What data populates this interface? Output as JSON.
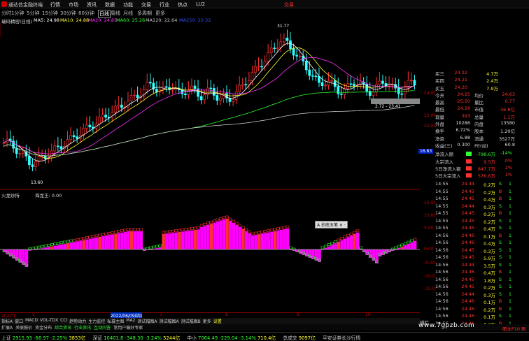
{
  "titlebar": {
    "app": "通达信金融终端",
    "menu": [
      "行情",
      "市场",
      "资讯",
      "数据",
      "功能",
      "交易",
      "行业",
      "热点",
      "LU2"
    ],
    "right": "交易"
  },
  "toolbar": {
    "items": [
      "分时",
      "1分钟",
      "5分钟",
      "15分钟",
      "30分钟",
      "60分钟",
      "日线",
      "周线",
      "月线",
      "多周期",
      "更多"
    ],
    "active": "日线"
  },
  "chart_title": "瑞玛精密(日线)",
  "ma_legend": [
    {
      "label": "MA5: 24.98",
      "color": "#ffffff"
    },
    {
      "label": "MA10: 24.88",
      "color": "#ffff30"
    },
    {
      "label": "MA20: 24.85",
      "color": "#ff30ff"
    },
    {
      "label": "MA60: 25.26",
      "color": "#30ff30"
    },
    {
      "label": "MA120: 22.64",
      "color": "#c8c8c8"
    },
    {
      "label": "MA250: 20.32",
      "color": "#3050ff"
    }
  ],
  "price_axis": [
    "24.00",
    "22.00",
    "20.00"
  ],
  "annotations": {
    "high": "31.77",
    "low": "13.60",
    "range_label": "2.72 - 23.41"
  },
  "indicator": {
    "title": "火龙炒持",
    "name": "海龙王: 0.00",
    "axis": [
      "15.00",
      "10.00",
      "5.00",
      "0.00",
      "-5.00",
      "-10.00",
      "-15.00"
    ],
    "popup": "A 抄底五笔 ✕ ·"
  },
  "date_axis": [
    "2022年",
    "5",
    "2022/06/09(四)",
    "7",
    "8",
    "9",
    "10"
  ],
  "indicator_tabs": [
    "指标A",
    "窗口",
    "MACD",
    "VOL-TDX",
    "CCI",
    "趋势动力",
    "主力监控",
    "私募主图",
    "MA2",
    "测试幅图A",
    "测试幅图A",
    "测试幅图B",
    "更多",
    "设置"
  ],
  "info_tabs": [
    "扩展A",
    "关联报价",
    "资金分布",
    "综合资讯",
    "行业资讯",
    "互动问答",
    "常用户偏好专家"
  ],
  "side": {
    "orderbook": [
      {
        "label": "买三",
        "price": "24.22",
        "vol": "4.7万"
      },
      {
        "label": "买四",
        "price": "24.21",
        "vol": "2.4万"
      },
      {
        "label": "买五",
        "price": "24.20",
        "vol": "7.9万"
      }
    ],
    "stats": [
      {
        "l1": "今开",
        "v1": "24.25",
        "l2": "均价",
        "v2": "24.63"
      },
      {
        "l1": "最高",
        "v1": "25.50",
        "l2": "量比",
        "v2": "0.77"
      },
      {
        "l1": "最低",
        "v1": "24.28",
        "l2": "市值",
        "v2": "36.8亿"
      },
      {
        "l1": "现量",
        "v1": "393",
        "l2": "总量",
        "v2": "1.1万"
      },
      {
        "l1": "外盘",
        "v1": "10286",
        "l2": "内盘",
        "v2": "13580"
      },
      {
        "l1": "换手",
        "v1": "6.72%",
        "l2": "股本",
        "v2": "1.20亿"
      },
      {
        "l1": "净资",
        "v1": "6.88",
        "l2": "流通",
        "v2": "3527万"
      },
      {
        "l1": "收益(三)",
        "v1": "0.300",
        "l2": "PE(动)",
        "v2": "60.8"
      }
    ],
    "flows": [
      {
        "label": "净流入额",
        "val": "-798.6万",
        "pct": "-14%",
        "color": "#30ff30"
      },
      {
        "label": "大宗流入",
        "val": "9.5万",
        "pct": "0%",
        "color": "#ff3030"
      },
      {
        "label": "5日净流入额",
        "val": "847.7万",
        "pct": "2%",
        "color": "#ff3030"
      },
      {
        "label": "5日大宗流入",
        "val": "578.6万",
        "pct": "1%",
        "color": "#ff3030"
      }
    ],
    "ticks": [
      [
        "14:55",
        "24.44",
        "0.2万",
        "S"
      ],
      [
        "14:55",
        "24.45",
        "0.2万",
        "B"
      ],
      [
        "14:55",
        "24.45",
        "0.4万",
        "B"
      ],
      [
        "14:55",
        "24.44",
        "0.3万",
        "S"
      ],
      [
        "14:55",
        "24.45",
        "0.2万",
        "B"
      ],
      [
        "14:55",
        "24.45",
        "0.2万",
        "S"
      ],
      [
        "14:55",
        "24.45",
        "0.4万",
        "S"
      ],
      [
        "14:56",
        "24.46",
        "0.1万",
        "B"
      ],
      [
        "14:56",
        "24.46",
        "0.4万",
        "S"
      ],
      [
        "14:56",
        "24.45",
        "0.3万",
        "S"
      ],
      [
        "14:56",
        "24.45",
        "5.9万",
        "S"
      ],
      [
        "14:56",
        "24.44",
        "3.5万",
        "S"
      ],
      [
        "14:56",
        "24.46",
        "0.4万",
        "B"
      ],
      [
        "14:56",
        "24.45",
        "1.8万",
        "S"
      ],
      [
        "14:56",
        "24.45",
        "0.2万",
        "S"
      ],
      [
        "14:56",
        "24.44",
        "0.3万",
        "S"
      ],
      [
        "14:56",
        "24.46",
        "0.1万",
        "B"
      ],
      [
        "14:56",
        "24.46",
        "0.2万",
        "B"
      ],
      [
        "14:56",
        "24.46",
        "0.1万",
        "S"
      ],
      [
        "14:56",
        "24.46",
        "0.2万",
        "B"
      ]
    ],
    "label_1683": "16.83"
  },
  "bottom": {
    "tail_label": "横栏",
    "status_right": "图文F10 刷",
    "indices": [
      {
        "name": "上证",
        "value": "2915.93",
        "chg": "-66.97",
        "pct": "-2.25%",
        "amt": "3853亿"
      },
      {
        "name": "深证",
        "value": "10401.8",
        "chg": "-348.30",
        "pct": "-3.24%",
        "amt": "5244亿"
      },
      {
        "name": "中小",
        "value": "7064.49",
        "chg": "-229.04",
        "pct": "-3.14%",
        "amt": "710.4亿"
      },
      {
        "name": "总成交",
        "value": "9097亿",
        "chg": "",
        "pct": "",
        "amt": ""
      }
    ],
    "ticker": "平安证券长沙行情"
  },
  "watermark": "www.7gpzb.com",
  "colors": {
    "up": "#ff3030",
    "down": "#30ff30",
    "magenta": "#ff00ff",
    "yellow": "#ffff30"
  }
}
